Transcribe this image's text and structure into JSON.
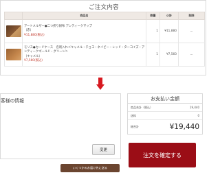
{
  "order": {
    "title": "ご注文内容",
    "headers": {
      "product": "商品名",
      "qty": "数量",
      "subtotal": "小計",
      "delete": "削除"
    },
    "items": [
      {
        "thumb_icon": "wallet-icon",
        "name": "アートメルザー●二つ折り財布 アンティークマップ",
        "option": "（赤）",
        "price": "¥11,880(税込)",
        "qty": "1",
        "subtotal": "¥11,880",
        "delete": "－"
      },
      {
        "thumb_icon": "card-case-icon",
        "name": "モリス●カードケース　名刺入れ＜キャメル・チョコ・ネイビー・レッド・ターコイズ・アンティークゴールド・グリーン＞",
        "option": "（キャメル）",
        "price": "¥7,560(税込)",
        "qty": "1",
        "subtotal": "¥7,560",
        "delete": "－"
      }
    ]
  },
  "customer": {
    "title": "客様の情報",
    "change_label": "変更"
  },
  "payment": {
    "title": "お支払い金額",
    "rows": [
      {
        "label": "商品合計（税込）",
        "value": "19,440"
      },
      {
        "label": "送料",
        "value": "0"
      }
    ],
    "total_label": "総合計",
    "total_value": "¥19,440",
    "confirm_label": "注文を確定する"
  },
  "back_label": "いくつかのお届け先に送る",
  "colors": {
    "accent_red": "#d71920",
    "confirm": "#9b0d16",
    "back": "#6b4530",
    "header_bg": "#efe9e4",
    "price_red": "#c0392b"
  }
}
